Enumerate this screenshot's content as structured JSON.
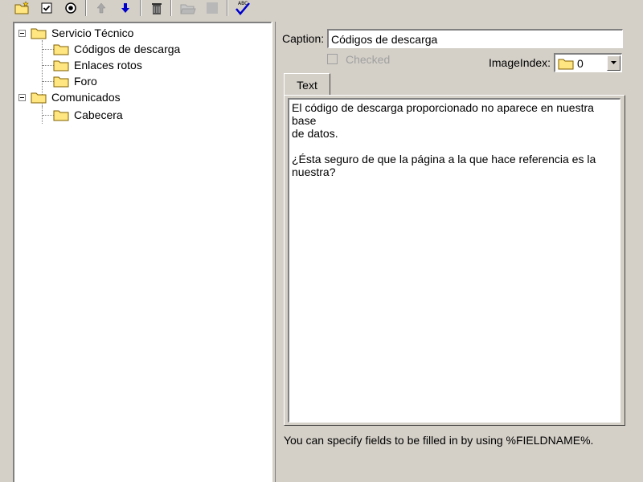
{
  "toolbar": {
    "buttons": [
      {
        "icon": "new-folder-icon"
      },
      {
        "icon": "checkbox-icon"
      },
      {
        "icon": "radio-icon"
      },
      {
        "icon": "arrow-up-icon"
      },
      {
        "icon": "arrow-down-icon"
      },
      {
        "icon": "trash-icon"
      },
      {
        "icon": "open-folder-icon"
      },
      {
        "icon": "stop-icon"
      },
      {
        "icon": "spellcheck-icon"
      }
    ]
  },
  "tree": {
    "nodes": [
      {
        "label": "Servicio Técnico",
        "level": 0,
        "expanded": true
      },
      {
        "label": "Códigos de descarga",
        "level": 1
      },
      {
        "label": "Enlaces rotos",
        "level": 1
      },
      {
        "label": "Foro",
        "level": 1
      },
      {
        "label": "Comunicados",
        "level": 0,
        "expanded": true
      },
      {
        "label": "Cabecera",
        "level": 1
      }
    ]
  },
  "editor": {
    "caption_label": "Caption:",
    "caption_value": "Códigos de descarga",
    "checked_label": "Checked",
    "checked": false,
    "image_index_label": "ImageIndex:",
    "image_index_value": "0",
    "tab_label": "Text",
    "text_lines": [
      "El código de descarga proporcionado no aparece en nuestra base",
      "de datos.",
      "",
      "¿Ésta seguro de que la página a la que hace referencia es la",
      "nuestra?"
    ],
    "hint": "You can specify fields to be filled in by using %FIELDNAME%."
  },
  "colors": {
    "face": "#d4d0c8",
    "folder_yellow": "#ffe680",
    "arrow_blue": "#0000cc"
  }
}
